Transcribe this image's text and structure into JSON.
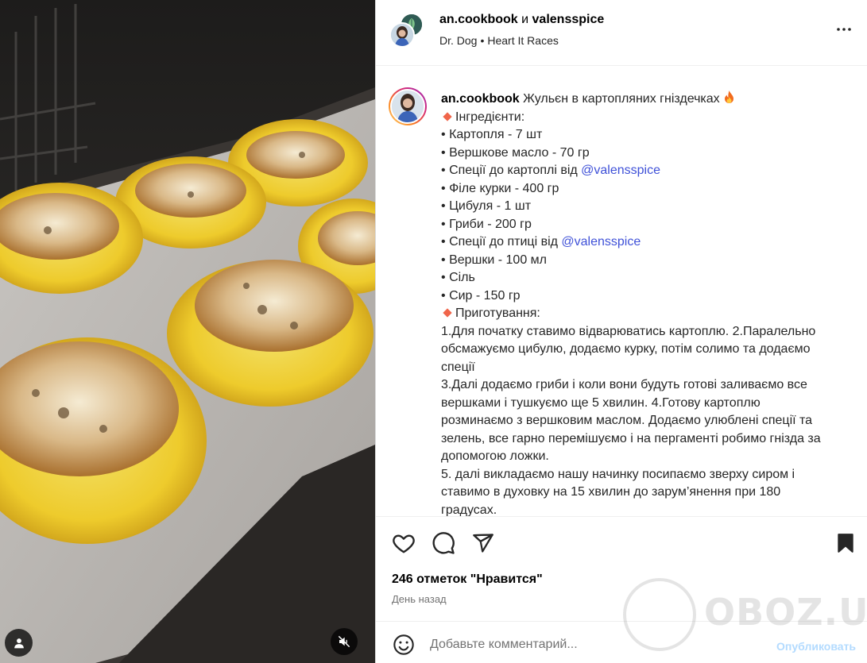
{
  "header": {
    "author": "an.cookbook",
    "conjunction": "и",
    "collaborator": "valensspice",
    "music_artist": "Dr. Dog",
    "music_separator": "•",
    "music_track": "Heart It Races",
    "more_icon": "more-horizontal-icon"
  },
  "caption": {
    "username": "an.cookbook",
    "title": "Жульєн в картопляних гніздечках",
    "title_emoji": "fire-emoji",
    "ingredients_heading": "Інгредієнти:",
    "bullet": "•",
    "ingredients": [
      {
        "text": "Картопля - 7 шт"
      },
      {
        "text": "Вершкове масло - 70 гр"
      },
      {
        "text": "Спеції до картоплі від ",
        "mention": "@valensspice"
      },
      {
        "text": "Філе курки - 400 гр"
      },
      {
        "text": "Цибуля - 1 шт"
      },
      {
        "text": "Гриби - 200 гр"
      },
      {
        "text": "Спеції до птиці від ",
        "mention": "@valensspice"
      },
      {
        "text": "Вершки - 100 мл"
      },
      {
        "text": "Сіль"
      },
      {
        "text": "Сир - 150 гр"
      }
    ],
    "method_heading": "Приготування:",
    "method_lines": [
      "1.Для початку ставимо відварюватись картоплю. 2.Паралельно",
      "обсмажуємо цибулю, додаємо курку, потім солимо та додаємо",
      "спеції",
      "3.Далі додаємо гриби і коли вони будуть готові заливаємо все",
      "вершками і тушкуємо ще 5 хвилин. 4.Готову картоплю",
      "розминаємо з вершковим маслом. Додаємо улюблені спеції та",
      "зелень, все гарно перемішуємо і на пергаменті робимо гнізда за",
      "допомогою ложки.",
      "5. далі викладаємо нашу начинку посипаємо зверху сиром і",
      "ставимо в духовку на 15 хвилин до зарум’янення при 180",
      "градусах."
    ],
    "accent_color": "#3f51d8",
    "diamond_color": "#f0654a"
  },
  "actions": {
    "icons": [
      "heart-icon",
      "comment-icon",
      "share-icon",
      "bookmark-icon"
    ],
    "likes_count": "246",
    "likes_label": "отметок \"Нравится\"",
    "timestamp": "День назад"
  },
  "comment": {
    "emoji_icon": "emoji-smile-icon",
    "placeholder": "Добавьте комментарий...",
    "publish_label": "Опубликовать",
    "publish_color": "#b3dbff"
  },
  "media": {
    "tag_icon": "user-tag-icon",
    "mute_icon": "muted-speaker-icon"
  },
  "watermark": {
    "text": "OBOZ.UA"
  }
}
